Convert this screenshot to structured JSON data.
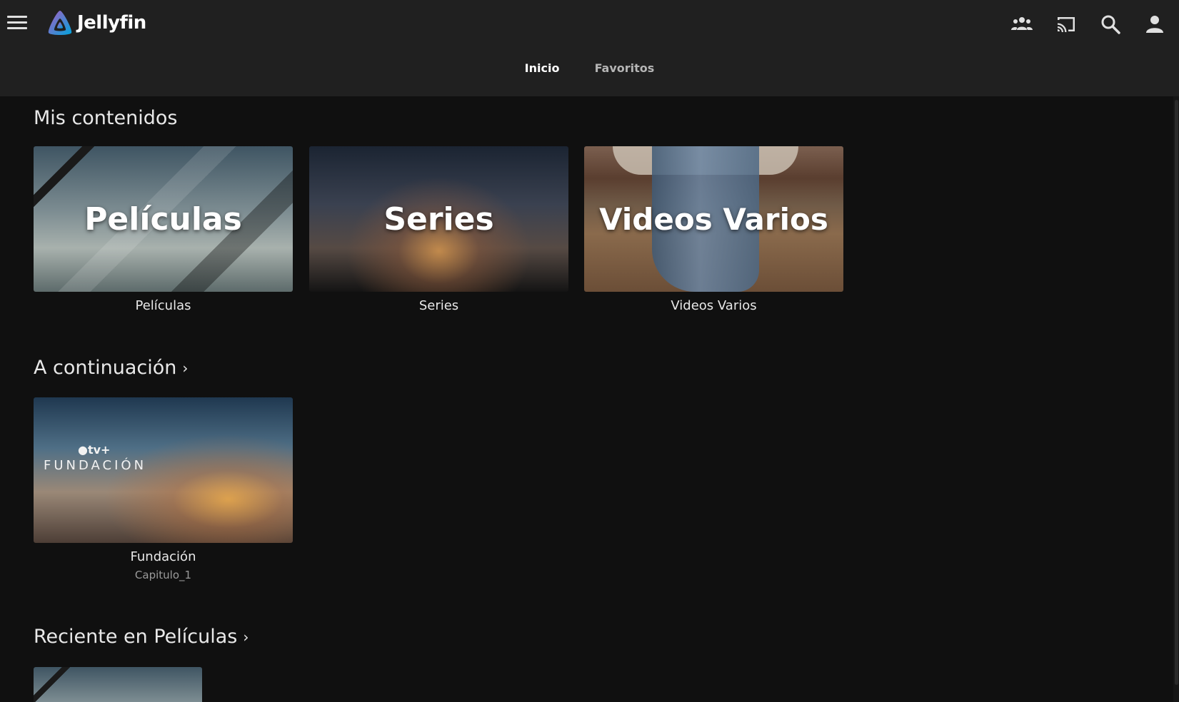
{
  "app": {
    "name": "Jellyfin"
  },
  "header": {
    "icons": [
      "menu-icon",
      "sync-play-icon",
      "cast-icon",
      "search-icon",
      "user-icon"
    ]
  },
  "tabs": [
    {
      "label": "Inicio",
      "active": true
    },
    {
      "label": "Favoritos",
      "active": false
    }
  ],
  "sections": {
    "mis_contenidos": {
      "title": "Mis contenidos",
      "items": [
        {
          "overlay": "Películas",
          "label": "Películas"
        },
        {
          "overlay": "Series",
          "label": "Series"
        },
        {
          "overlay": "Videos Varios",
          "label": "Videos Varios"
        }
      ]
    },
    "continuacion": {
      "title": "A continuación",
      "items": [
        {
          "label": "Fundación",
          "sublabel": "Capitulo_1",
          "poster_brand": "tv+",
          "poster_title": "FUNDACIÓN"
        }
      ]
    },
    "reciente": {
      "title": "Reciente en Películas"
    }
  },
  "colors": {
    "header_bg": "#202020",
    "page_bg": "#101010",
    "accent": "#aa5cc3"
  }
}
